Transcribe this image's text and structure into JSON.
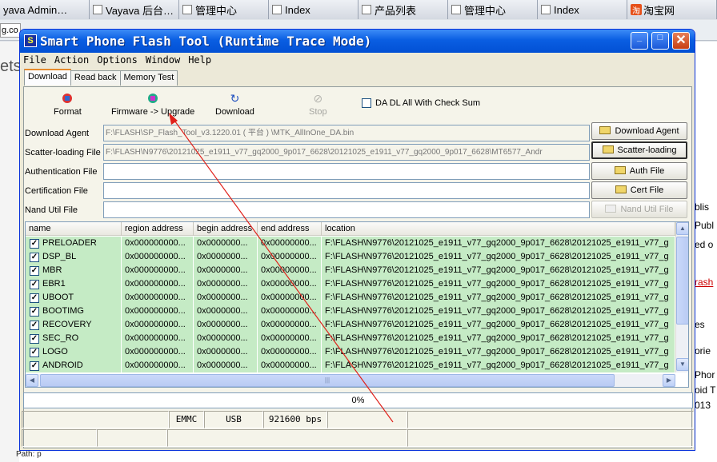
{
  "browser": {
    "tabs": [
      {
        "label": "yava Admin…",
        "has_checkbox": false
      },
      {
        "label": "Vayava 后台…",
        "has_checkbox": true
      },
      {
        "label": "管理中心",
        "has_checkbox": true
      },
      {
        "label": "Index",
        "has_checkbox": true
      },
      {
        "label": "产品列表",
        "has_checkbox": true
      },
      {
        "label": "管理中心",
        "has_checkbox": true
      },
      {
        "label": "Index",
        "has_checkbox": true
      },
      {
        "label": "淘宝网",
        "has_checkbox": false
      }
    ],
    "address_fragment": "g.co",
    "left_fragment": "ets",
    "right_fragments": [
      "blis",
      "Publ",
      "ed o",
      "rash",
      "es",
      "orie",
      "Phor",
      "oid T",
      "013"
    ],
    "status_path": "Path: p"
  },
  "window": {
    "title": "Smart Phone Flash Tool (Runtime Trace Mode)",
    "buttons": {
      "minimize": "_",
      "maximize": "□",
      "close": "✕"
    }
  },
  "menu": [
    "File",
    "Action",
    "Options",
    "Window",
    "Help"
  ],
  "tabs": [
    "Download",
    "Read back",
    "Memory Test"
  ],
  "toolbar": {
    "format": "Format",
    "firmware_upgrade": "Firmware -> Upgrade",
    "download": "Download",
    "stop": "Stop",
    "da_dl_checkbox": "DA DL All With Check Sum"
  },
  "fields": [
    {
      "label": "Download Agent",
      "value": "F:\\FLASH\\SP_Flash_Tool_v3.1220.01 ( 平台 ) \\MTK_AllInOne_DA.bin",
      "button": "Download Agent",
      "gray": true,
      "focused": false,
      "disabled": false
    },
    {
      "label": "Scatter-loading File",
      "value": "F:\\FLASH\\N9776\\20121025_e1911_v77_gq2000_9p017_6628\\20121025_e1911_v77_gq2000_9p017_6628\\MT6577_Andr",
      "button": "Scatter-loading",
      "gray": true,
      "focused": true,
      "disabled": false
    },
    {
      "label": "Authentication File",
      "value": "",
      "button": "Auth File",
      "gray": false,
      "focused": false,
      "disabled": false
    },
    {
      "label": "Certification File",
      "value": "",
      "button": "Cert File",
      "gray": false,
      "focused": false,
      "disabled": false
    },
    {
      "label": "Nand Util File",
      "value": "",
      "button": "Nand Util File",
      "gray": false,
      "focused": false,
      "disabled": true
    }
  ],
  "table": {
    "columns": [
      "name",
      "region address",
      "begin address",
      "end address",
      "location"
    ],
    "rows": [
      {
        "name": "PRELOADER",
        "region": "0x000000000...",
        "begin": "0x0000000...",
        "end": "0x00000000...",
        "location": "F:\\FLASH\\N9776\\20121025_e1911_v77_gq2000_9p017_6628\\20121025_e1911_v77_g"
      },
      {
        "name": "DSP_BL",
        "region": "0x000000000...",
        "begin": "0x0000000...",
        "end": "0x00000000...",
        "location": "F:\\FLASH\\N9776\\20121025_e1911_v77_gq2000_9p017_6628\\20121025_e1911_v77_g"
      },
      {
        "name": "MBR",
        "region": "0x000000000...",
        "begin": "0x0000000...",
        "end": "0x00000000...",
        "location": "F:\\FLASH\\N9776\\20121025_e1911_v77_gq2000_9p017_6628\\20121025_e1911_v77_g"
      },
      {
        "name": "EBR1",
        "region": "0x000000000...",
        "begin": "0x0000000...",
        "end": "0x00000000...",
        "location": "F:\\FLASH\\N9776\\20121025_e1911_v77_gq2000_9p017_6628\\20121025_e1911_v77_g"
      },
      {
        "name": "UBOOT",
        "region": "0x000000000...",
        "begin": "0x0000000...",
        "end": "0x00000000...",
        "location": "F:\\FLASH\\N9776\\20121025_e1911_v77_gq2000_9p017_6628\\20121025_e1911_v77_g"
      },
      {
        "name": "BOOTIMG",
        "region": "0x000000000...",
        "begin": "0x0000000...",
        "end": "0x00000000...",
        "location": "F:\\FLASH\\N9776\\20121025_e1911_v77_gq2000_9p017_6628\\20121025_e1911_v77_g"
      },
      {
        "name": "RECOVERY",
        "region": "0x000000000...",
        "begin": "0x0000000...",
        "end": "0x00000000...",
        "location": "F:\\FLASH\\N9776\\20121025_e1911_v77_gq2000_9p017_6628\\20121025_e1911_v77_g"
      },
      {
        "name": "SEC_RO",
        "region": "0x000000000...",
        "begin": "0x0000000...",
        "end": "0x00000000...",
        "location": "F:\\FLASH\\N9776\\20121025_e1911_v77_gq2000_9p017_6628\\20121025_e1911_v77_g"
      },
      {
        "name": "LOGO",
        "region": "0x000000000...",
        "begin": "0x0000000...",
        "end": "0x00000000...",
        "location": "F:\\FLASH\\N9776\\20121025_e1911_v77_gq2000_9p017_6628\\20121025_e1911_v77_g"
      },
      {
        "name": "ANDROID",
        "region": "0x000000000...",
        "begin": "0x0000000...",
        "end": "0x00000000...",
        "location": "F:\\FLASH\\N9776\\20121025_e1911_v77_gq2000_9p017_6628\\20121025_e1911_v77_g"
      }
    ]
  },
  "progress": {
    "label": "0%",
    "value": 0
  },
  "status": {
    "storage": "EMMC",
    "interface": "USB",
    "baud": "921600 bps"
  },
  "colors": {
    "titlebar": "#0a5ee2",
    "row_highlight": "#c5ebc5",
    "annotation_arrow": "#e0201a"
  },
  "icons": {
    "format": "format-icon",
    "firmware": "firmware-upgrade-icon",
    "download": "download-refresh-icon",
    "stop": "stop-icon",
    "folder": "folder-icon"
  }
}
